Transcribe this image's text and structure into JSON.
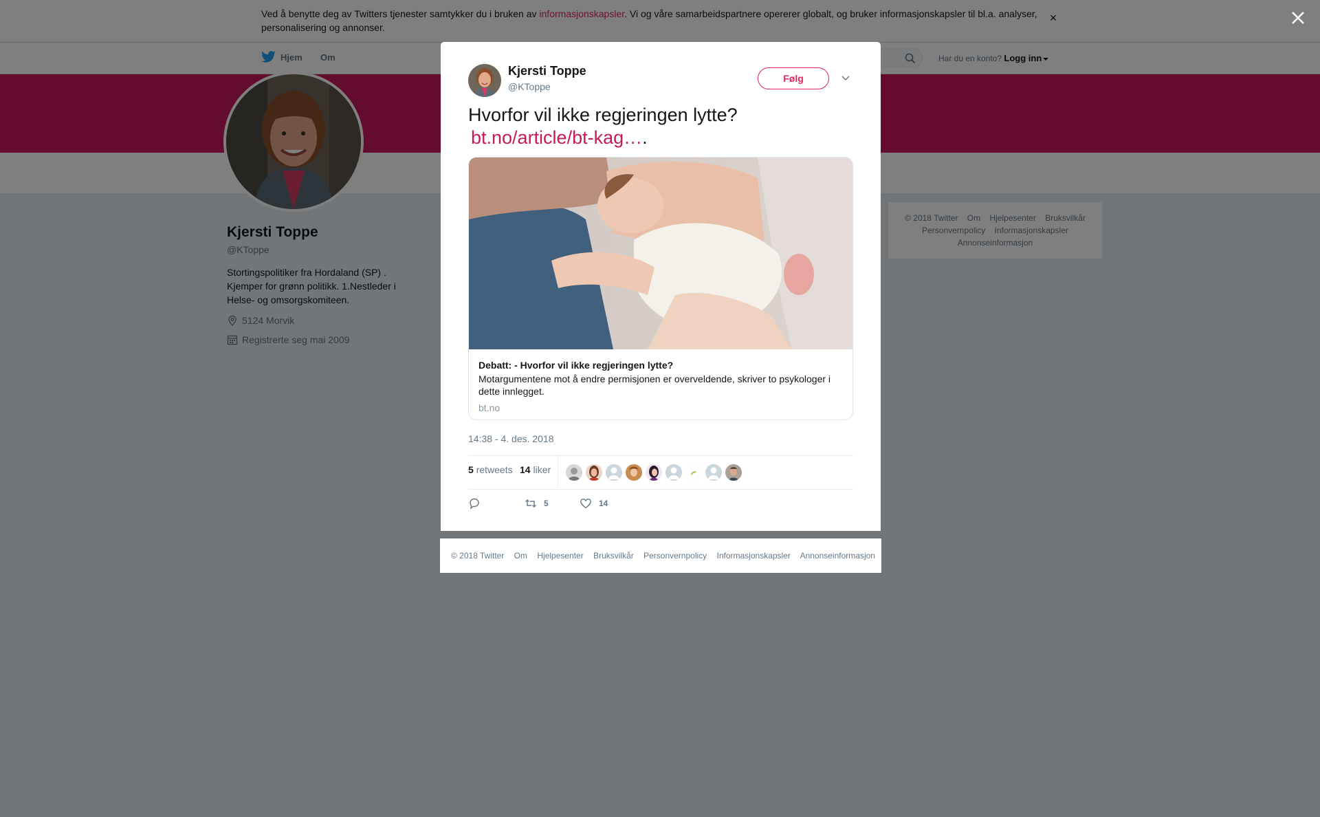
{
  "cookie": {
    "prefix": "Ved å benytte deg av Twitters tjenester samtykker du i bruken av ",
    "link": "informasjonskapsler",
    "suffix": ". Vi og våre samarbeidspartnere opererer globalt, og bruker informasjonskapsler til bl.a. analyser, personalisering og annonser.",
    "close": "×"
  },
  "nav": {
    "home": "Hjem",
    "about": "Om",
    "login_prompt": "Har du en konto?",
    "login": "Logg inn"
  },
  "profile": {
    "name": "Kjersti Toppe",
    "handle": "@KToppe",
    "bio": "Stortingspolitiker fra Hordaland (SP) . Kjemper for grønn politikk. 1.Nestleder i Helse- og omsorgskomiteen.",
    "location": "5124 Morvik",
    "joined": "Registrerte seg mai 2009"
  },
  "sidebar_footer": {
    "items": [
      "© 2018 Twitter",
      "Om",
      "Hjelpesenter",
      "Bruksvilkår",
      "Personvernpolicy",
      "Informasjonskapsler",
      "Annonseinformasjon"
    ]
  },
  "tweet": {
    "name": "Kjersti Toppe",
    "handle": "@KToppe",
    "follow": "Følg",
    "text": "Hvorfor vil ikke regjeringen lytte?",
    "link": "bt.no/article/bt-kag…",
    "link_suffix": ".",
    "card": {
      "title": "Debatt: - Hvorfor vil ikke regjeringen lytte?",
      "description": "Motargumentene mot å endre permisjonen er overveldende, skriver to psykologer i dette innlegget.",
      "domain": "bt.no"
    },
    "time": "14:38 - 4. des. 2018",
    "retweets": "5",
    "retweets_label": "retweets",
    "likes": "14",
    "likes_label": "liker",
    "action_retweets": "5",
    "action_likes": "14"
  },
  "modal_footer": {
    "items": [
      "© 2018 Twitter",
      "Om",
      "Hjelpesenter",
      "Bruksvilkår",
      "Personvernpolicy",
      "Informasjonskapsler",
      "Annonseinformasjon"
    ]
  },
  "colors": {
    "brand": "#e0245e",
    "banner": "#c8195a",
    "overlay": "rgba(0,0,0,0.5)"
  },
  "icons": [
    "twitter-bird-icon",
    "search-icon",
    "location-icon",
    "calendar-icon",
    "close-icon",
    "chevron-down-icon",
    "reply-icon",
    "retweet-icon",
    "heart-icon"
  ]
}
